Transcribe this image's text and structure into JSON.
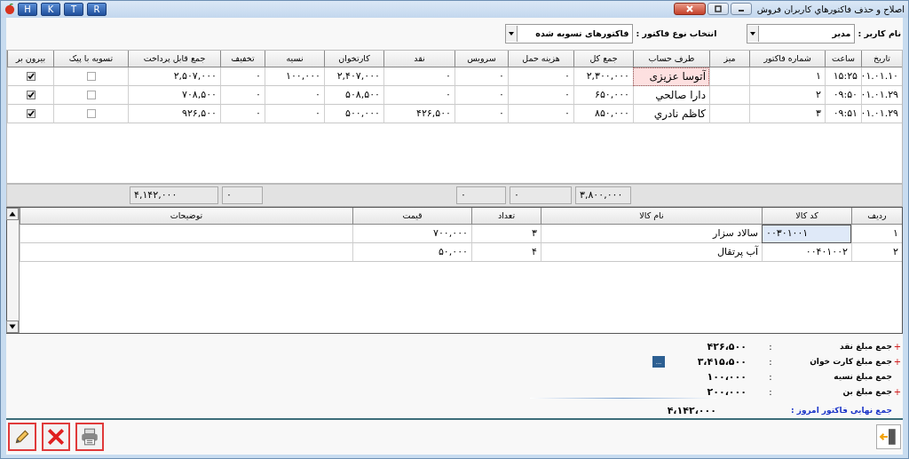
{
  "window": {
    "title": "اصلاح و حذف فاکتورهاي کاربران فروش",
    "quick_buttons": [
      "R",
      "T",
      "K",
      "H"
    ]
  },
  "filters": [
    {
      "label": "نام کاربر :",
      "value": "مدیر"
    },
    {
      "label": "انتخاب نوع فاکتور :",
      "value": "فاکتورهای تسویه شده"
    }
  ],
  "invoices": {
    "columns": [
      {
        "title": "تاریخ",
        "kind": "text"
      },
      {
        "title": "ساعت",
        "kind": "text"
      },
      {
        "title": "شماره فاکتور",
        "kind": "text"
      },
      {
        "title": "میز",
        "kind": "text"
      },
      {
        "title": "طرف حساب",
        "kind": "name"
      },
      {
        "title": "جمع کل",
        "kind": "text",
        "total": "۳,۸۰۰,۰۰۰"
      },
      {
        "title": "هزینه حمل",
        "kind": "text",
        "total": "۰"
      },
      {
        "title": "سرویس",
        "kind": "text",
        "total": "۰"
      },
      {
        "title": "نقد",
        "kind": "text"
      },
      {
        "title": "کارتخوان",
        "kind": "text"
      },
      {
        "title": "نسیه",
        "kind": "text"
      },
      {
        "title": "تخفیف",
        "kind": "text",
        "total": "۰"
      },
      {
        "title": "جمع قابل پرداخت",
        "kind": "text",
        "total": "۴,۱۴۲,۰۰۰"
      },
      {
        "title": "تسویه با پیک",
        "kind": "check"
      },
      {
        "title": "بیرون بر",
        "kind": "check"
      }
    ],
    "rows": [
      {
        "selected": true,
        "cells": [
          "۰۱.۰۱.۱۰",
          "۱۵:۲۵",
          "۱",
          null,
          "آتوسا عزیزی",
          "۲,۳۰۰,۰۰۰",
          "۰",
          "۰",
          "۰",
          "۲,۴۰۷,۰۰۰",
          "۱۰۰,۰۰۰",
          "۰",
          "۲,۵۰۷,۰۰۰",
          false,
          true
        ]
      },
      {
        "selected": false,
        "cells": [
          "۰۱.۰۱.۲۹",
          "۰۹:۵۰",
          "۲",
          null,
          "دارا صالحي",
          "۶۵۰,۰۰۰",
          "۰",
          "۰",
          "۰",
          "۵۰۸,۵۰۰",
          "۰",
          "۰",
          "۷۰۸,۵۰۰",
          false,
          true
        ]
      },
      {
        "selected": false,
        "cells": [
          "۰۱.۰۱.۲۹",
          "۰۹:۵۱",
          "۳",
          null,
          "کاظم نادري",
          "۸۵۰,۰۰۰",
          "۰",
          "۰",
          "۴۲۶,۵۰۰",
          "۵۰۰,۰۰۰",
          "۰",
          "۰",
          "۹۲۶,۵۰۰",
          false,
          true
        ]
      }
    ]
  },
  "items": {
    "columns": [
      {
        "title": "ردیف",
        "kind": "text"
      },
      {
        "title": "کد کالا",
        "kind": "code"
      },
      {
        "title": "نام کالا",
        "kind": "name"
      },
      {
        "title": "تعداد",
        "kind": "text"
      },
      {
        "title": "قیمت",
        "kind": "text"
      },
      {
        "title": "توضیحات",
        "kind": "text"
      }
    ],
    "rows": [
      {
        "selected": true,
        "cells": [
          "۱",
          "۰۰۳۰۱۰۰۱",
          "سالاد سزار",
          "۳",
          "۷۰۰,۰۰۰",
          null
        ]
      },
      {
        "selected": false,
        "cells": [
          "۲",
          "۰۰۴۰۱۰۰۲",
          "آب پرتقال",
          "۴",
          "۵۰,۰۰۰",
          null
        ]
      }
    ]
  },
  "summary": [
    {
      "plus": "+",
      "label": "جمع مبلغ نقد",
      "colon": ":",
      "value": "۴۲۶،۵۰۰",
      "kind": "plain"
    },
    {
      "plus": "+",
      "label": "جمع مبلغ کارت خوان",
      "colon": ":",
      "value": "۳،۴۱۵،۵۰۰",
      "kind": "more",
      "button": "..."
    },
    {
      "label": "جمع مبلغ نسیه",
      "colon": ":",
      "value": "۱۰۰،۰۰۰",
      "kind": "plain"
    },
    {
      "plus": "+",
      "label": "جمع مبلغ بن",
      "colon": ":",
      "value": "۲۰۰،۰۰۰",
      "kind": "plain"
    },
    {
      "label": "جمع نهایی فاکتور امروز :",
      "value": "۴،۱۴۲،۰۰۰",
      "kind": "final"
    }
  ]
}
